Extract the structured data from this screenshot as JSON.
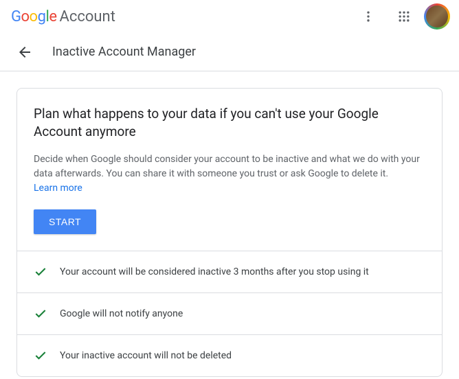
{
  "header": {
    "brand": "Google",
    "product": "Account"
  },
  "subheader": {
    "title": "Inactive Account Manager"
  },
  "card": {
    "title": "Plan what happens to your data if you can't use your Google Account anymore",
    "description": "Decide when Google should consider your account to be inactive and what we do with your data afterwards. You can share it with someone you trust or ask Google to delete it.",
    "learn_more": "Learn more",
    "start_button": "START"
  },
  "status_items": [
    {
      "text": "Your account will be considered inactive 3 months after you stop using it"
    },
    {
      "text": "Google will not notify anyone"
    },
    {
      "text": "Your inactive account will not be deleted"
    }
  ]
}
